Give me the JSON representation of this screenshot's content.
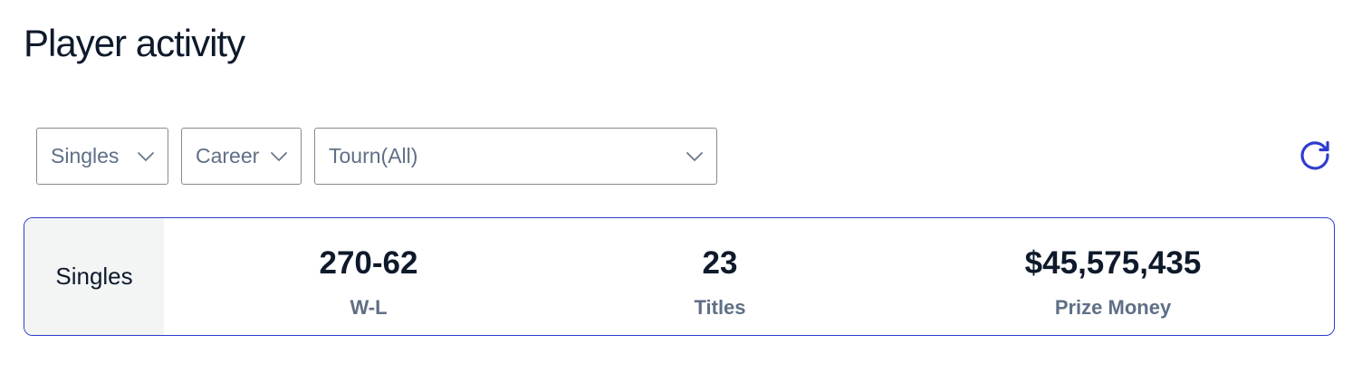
{
  "title": "Player activity",
  "filters": {
    "type": "Singles",
    "period": "Career",
    "tournament": "Tourn(All)"
  },
  "icons": {
    "dropdown": "chevron-down-icon",
    "refresh": "refresh-icon"
  },
  "colors": {
    "accent": "#2f3ccf",
    "text_primary": "#0e1a2b",
    "text_secondary": "#5f6f86",
    "label_cell_bg": "#f3f5f5"
  },
  "stats": {
    "label": "Singles",
    "win_loss": {
      "value": "270-62",
      "caption": "W-L"
    },
    "titles": {
      "value": "23",
      "caption": "Titles"
    },
    "prize_money": {
      "value": "$45,575,435",
      "caption": "Prize Money"
    }
  }
}
